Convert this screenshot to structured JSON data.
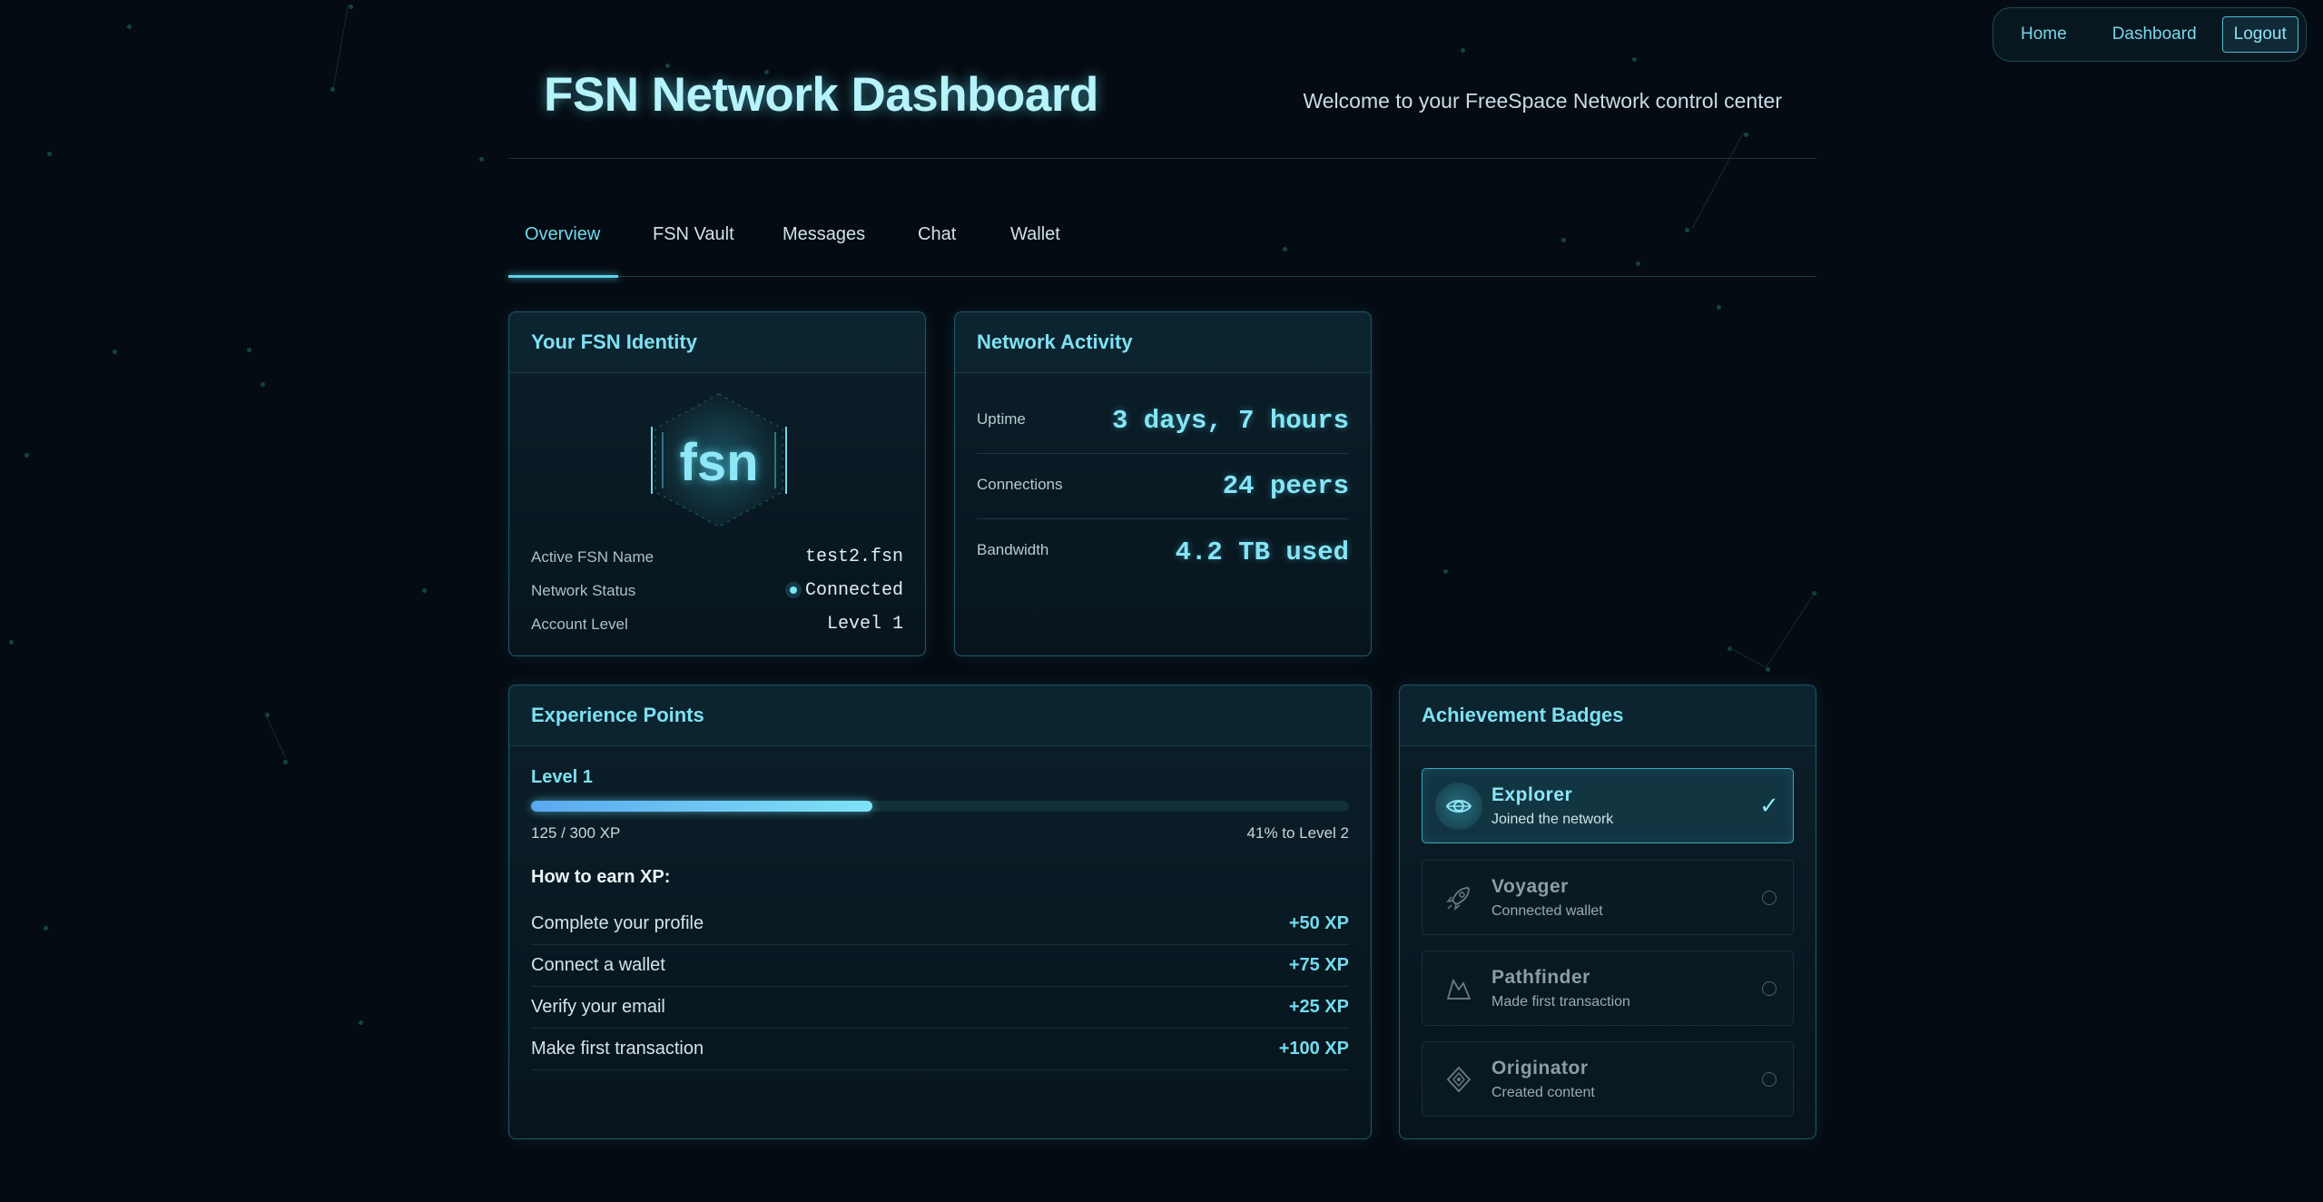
{
  "nav": {
    "home": "Home",
    "dashboard": "Dashboard",
    "logout": "Logout"
  },
  "header": {
    "title": "FSN Network Dashboard",
    "welcome": "Welcome to your FreeSpace Network control center"
  },
  "tabs": [
    {
      "label": "Overview",
      "active": true
    },
    {
      "label": "FSN Vault"
    },
    {
      "label": "Messages"
    },
    {
      "label": "Chat"
    },
    {
      "label": "Wallet"
    }
  ],
  "identity": {
    "title": "Your FSN Identity",
    "logo_text": "fsn",
    "rows": [
      {
        "label": "Active FSN Name",
        "value": "test2.fsn"
      },
      {
        "label": "Network Status",
        "value": "Connected"
      },
      {
        "label": "Account Level",
        "value": "Level 1"
      }
    ]
  },
  "activity": {
    "title": "Network Activity",
    "rows": [
      {
        "label": "Uptime",
        "value": "3 days, 7 hours"
      },
      {
        "label": "Connections",
        "value": "24 peers"
      },
      {
        "label": "Bandwidth",
        "value": "4.2 TB used"
      }
    ]
  },
  "xp": {
    "title": "Experience Points",
    "level": "Level 1",
    "current_text": "125 / 300 XP",
    "progress_fraction": 0.417,
    "next_text": "41% to Level 2",
    "how_title": "How to earn XP:",
    "tasks": [
      {
        "task": "Complete your profile",
        "points": "+50 XP"
      },
      {
        "task": "Connect a wallet",
        "points": "+75 XP"
      },
      {
        "task": "Verify your email",
        "points": "+25 XP"
      },
      {
        "task": "Make first transaction",
        "points": "+100 XP"
      }
    ]
  },
  "badges": {
    "title": "Achievement Badges",
    "items": [
      {
        "name": "Explorer",
        "desc": "Joined the network",
        "earned": true,
        "icon": "eye-icon"
      },
      {
        "name": "Voyager",
        "desc": "Connected wallet",
        "earned": false,
        "icon": "rocket-icon"
      },
      {
        "name": "Pathfinder",
        "desc": "Made first transaction",
        "earned": false,
        "icon": "mountain-icon"
      },
      {
        "name": "Originator",
        "desc": "Created content",
        "earned": false,
        "icon": "gem-icon"
      }
    ]
  },
  "colors": {
    "accent": "#6fd8ec",
    "background": "#050b12",
    "card_border": "#1e5563"
  }
}
